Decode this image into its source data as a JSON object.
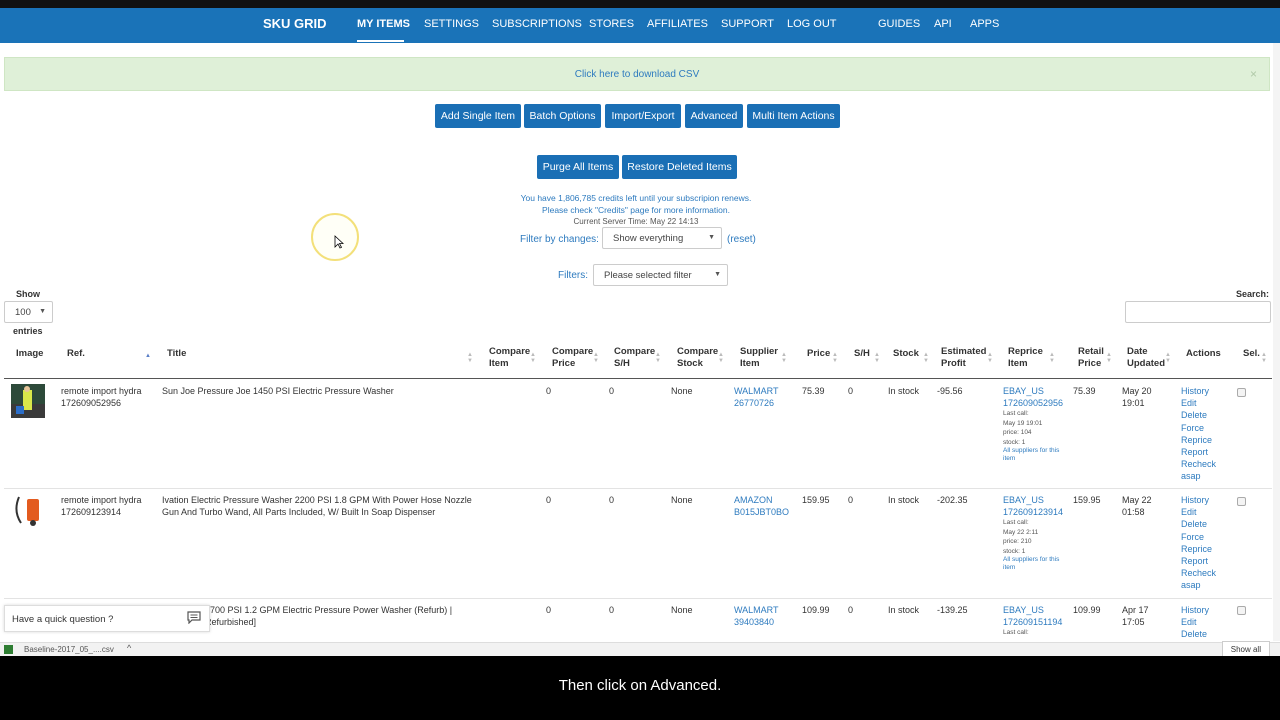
{
  "nav": {
    "brand": "SKU GRID",
    "links": [
      "MY ITEMS",
      "SETTINGS",
      "SUBSCRIPTIONS",
      "STORES",
      "AFFILIATES",
      "SUPPORT",
      "LOG OUT",
      "GUIDES",
      "API",
      "APPS"
    ],
    "active": "MY ITEMS"
  },
  "csv": {
    "link": "Click here to download CSV",
    "close": "×"
  },
  "toolbar": {
    "row1": [
      "Add Single Item",
      "Batch Options",
      "Import/Export",
      "Advanced",
      "Multi Item Actions"
    ],
    "row2": [
      "Purge All Items",
      "Restore Deleted Items"
    ]
  },
  "info": {
    "credits": "You have 1,806,785 credits left until your subscripion renews.",
    "check": "Please check \"Credits\" page for more information.",
    "server_time": "Current Server Time: May 22 14:13"
  },
  "filter_changes": {
    "label": "Filter by changes:",
    "value": "Show everything",
    "reset": "(reset)"
  },
  "filters": {
    "label": "Filters:",
    "value": "Please selected filter"
  },
  "length": {
    "show": "Show",
    "value": "100",
    "entries": "entries"
  },
  "search": {
    "label": "Search:",
    "value": ""
  },
  "columns": {
    "image": "Image",
    "ref": "Ref.",
    "title": "Title",
    "compare_item": [
      "Compare",
      "Item"
    ],
    "compare_price": [
      "Compare",
      "Price"
    ],
    "compare_sh": [
      "Compare",
      "S/H"
    ],
    "compare_stock": [
      "Compare",
      "Stock"
    ],
    "supplier_item": [
      "Supplier",
      "Item"
    ],
    "price": "Price",
    "sh": "S/H",
    "stock": "Stock",
    "est_profit": [
      "Estimated",
      "Profit"
    ],
    "reprice_item": [
      "Reprice",
      "Item"
    ],
    "retail_price": [
      "Retail",
      "Price"
    ],
    "date_updated": [
      "Date",
      "Updated"
    ],
    "actions": "Actions",
    "sel": "Sel."
  },
  "rows": [
    {
      "ref1": "remote import hydra",
      "ref2": "172609052956",
      "title1": "Sun Joe Pressure Joe 1450 PSI Electric Pressure Washer",
      "title2": "",
      "compare_price": "0",
      "compare_sh": "0",
      "compare_stock": "None",
      "supplier1": "WALMART",
      "supplier2": "26770726",
      "price": "75.39",
      "sh": "0",
      "stock": "In stock",
      "profit": "-95.56",
      "reprice1": "EBAY_US",
      "reprice2": "172609052956",
      "lastcall": "Last call:",
      "lastcall_time": "May 19 19:01",
      "lc_price": "price: 104",
      "lc_stock": "stock: 1",
      "all_suppliers": "All suppliers for this item",
      "retail": "75.39",
      "date1": "May 20",
      "date2": "19:01"
    },
    {
      "ref1": "remote import hydra",
      "ref2": "172609123914",
      "title1": "Ivation Electric Pressure Washer 2200 PSI 1.8 GPM With Power Hose Nozzle",
      "title2": "Gun And Turbo Wand, All Parts Included, W/ Built In Soap Dispenser",
      "compare_price": "0",
      "compare_sh": "0",
      "compare_stock": "None",
      "supplier1": "AMAZON",
      "supplier2": "B015JBT0BO",
      "price": "159.95",
      "sh": "0",
      "stock": "In stock",
      "profit": "-202.35",
      "reprice1": "EBAY_US",
      "reprice2": "172609123914",
      "lastcall": "Last call:",
      "lastcall_time": "May 22 2:11",
      "lc_price": "price: 210",
      "lc_stock": "stock: 1",
      "all_suppliers": "All suppliers for this item",
      "retail": "159.95",
      "date1": "May 22",
      "date2": "01:58"
    },
    {
      "ref1": "",
      "ref2": "",
      "title1": "1700 PSI 1.2 GPM Electric Pressure Power Washer (Refurb) |",
      "title2": "Refurbished]",
      "compare_price": "0",
      "compare_sh": "0",
      "compare_stock": "None",
      "supplier1": "WALMART",
      "supplier2": "39403840",
      "price": "109.99",
      "sh": "0",
      "stock": "In stock",
      "profit": "-139.25",
      "reprice1": "EBAY_US",
      "reprice2": "172609151194",
      "lastcall": "Last call:",
      "lastcall_time": "",
      "lc_price": "",
      "lc_stock": "",
      "all_suppliers": "",
      "retail": "109.99",
      "date1": "Apr 17",
      "date2": "17:05"
    }
  ],
  "actions": [
    "History",
    "Edit",
    "Delete",
    "Force",
    "Reprice",
    "Report",
    "Recheck",
    "asap"
  ],
  "chat": {
    "text": "Have a quick question ?"
  },
  "download": {
    "file": "Baseline-2017_05_....csv",
    "show_all": "Show all"
  },
  "caption": "Then click on Advanced.",
  "colors": {
    "nav": "#1a73b8",
    "button": "#1a6fb5",
    "link": "#2e7bbf",
    "csv_bg": "#dff0d8"
  }
}
